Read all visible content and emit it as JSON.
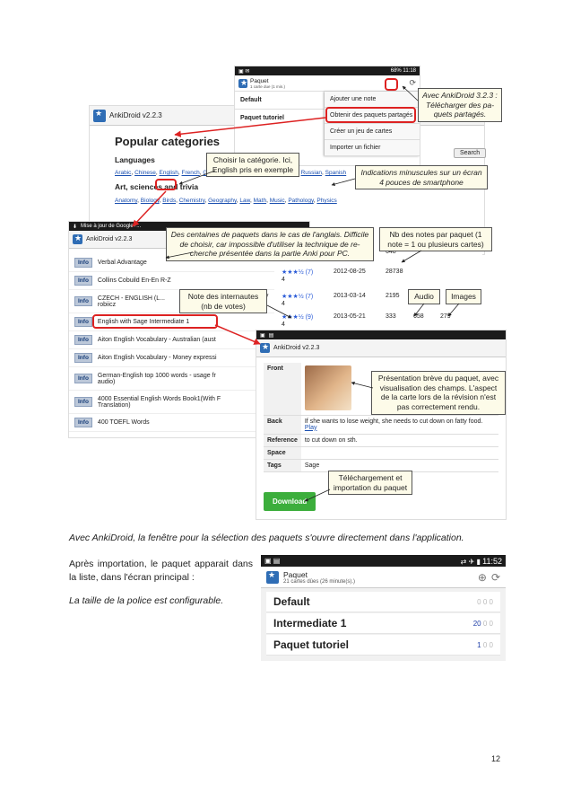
{
  "shot_main": {
    "app_title": "AnkiDroid v2.2.3",
    "heading": "Popular categories",
    "languages_label": "Languages",
    "languages_links": [
      "Arabic",
      "Chinese",
      "English",
      "French",
      "German",
      "Hebrew",
      "Japanese",
      "Korean",
      "Russian",
      "Spanish"
    ],
    "art_label": "Art, sciences and trivia",
    "art_links": [
      "Anatomy",
      "Biology",
      "Birds",
      "Chemistry",
      "Geography",
      "Law",
      "Math",
      "Music",
      "Pathology",
      "Physics"
    ],
    "search_button": "Search"
  },
  "shot_menu": {
    "status_time": "11:18",
    "status_battery": "68%",
    "title": "Paquet",
    "subtitle": "1 carte due (1 min.)",
    "decks": [
      "Default",
      "Paquet tutoriel"
    ],
    "menu_items": [
      "Ajouter une note",
      "Obtenir des paquets partagés",
      "Créer un jeu de cartes",
      "Importer un fichier"
    ]
  },
  "shot_list": {
    "notification": "Mise à jour de Google+...",
    "app_title": "AnkiDroid v2.2.3",
    "info_label": "Info",
    "rows": [
      {
        "name": "Verbal Advantage",
        "rating": "4",
        "date": "2012-12-30",
        "notes": "648",
        "audio": "",
        "images": ""
      },
      {
        "name": "Collins Cobuild En-En R-Z",
        "rating": "★★★½ (7)",
        "rating2": "4",
        "date": "2012-08-25",
        "notes": "28738",
        "audio": "",
        "images": ""
      },
      {
        "name": "CZECH - ENGLISH (L...",
        "sub": "robiicz",
        "by": "by",
        "rating": "★★★½ (7)",
        "rating2": "4",
        "date": "2013-03-14",
        "notes": "2195",
        "audio": "",
        "images": ""
      },
      {
        "name": "English with Sage Intermediate 1",
        "rating": "★★★½ (9)",
        "rating2": "4",
        "date": "2013-05-21",
        "notes": "333",
        "audio": "658",
        "images": "279"
      },
      {
        "name": "Aiton English Vocabulary - Australian (aust",
        "rating": "",
        "date": "",
        "notes": ""
      },
      {
        "name": "Aiton English Vocabulary - Money expressi",
        "rating": "",
        "date": "",
        "notes": ""
      },
      {
        "name": "German-English top 1000 words - usage fr",
        "sub": "audio)",
        "rating": "",
        "date": "",
        "notes": ""
      },
      {
        "name": "4000 Essential English Words Book1(With F",
        "sub": "Translation)",
        "rating": "",
        "date": "",
        "notes": ""
      },
      {
        "name": "400 TOEFL Words",
        "rating": "",
        "date": "",
        "notes": ""
      }
    ]
  },
  "shot_detail": {
    "app_title": "AnkiDroid v2.2.3",
    "fields": [
      {
        "key": "Front",
        "value": ""
      },
      {
        "key": "Back",
        "value": "If she wants to lose weight, she needs to cut down on fatty food.",
        "link": "Play"
      },
      {
        "key": "Reference",
        "value": "to cut down on sth."
      },
      {
        "key": "Space",
        "value": ""
      },
      {
        "key": "Tags",
        "value": "Sage"
      }
    ],
    "download_button": "Download"
  },
  "annotations": {
    "ankidroid_version": "Avec AnkiDroid 3.2.3 : Télécharger des pa-quets partagés.",
    "choose_category": "Choisir la catégorie. Ici, English pris en exemple",
    "small_text": "Indications minuscules sur un écran 4 pouces de smartphone",
    "hundreds_decks": "Des centaines de paquets dans le cas de l'anglais. Difficile de choisir, car impossible d'utiliser la technique de re-cherche présentée dans la partie Anki pour PC.",
    "nb_notes": "Nb des notes par paquet (1 note = 1 ou plusieurs cartes)",
    "user_rating": "Note des internautes (nb de votes)",
    "audio": "Audio",
    "images": "Images",
    "presentation": "Présentation brève du paquet, avec visualisation des champs. L'aspect de la carte lors de la révision n'est pas correctement rendu.",
    "download_note": "Téléchargement et importation du paquet"
  },
  "body_text": {
    "caption": "Avec AnkiDroid, la fenêtre pour la sélection des paquets s'ouvre directement dans l'application.",
    "after_import": "Après importation, le paquet apparait dans la liste, dans l'écran principal :",
    "font_size": "La taille de la police est configurable."
  },
  "shot_bottom": {
    "status_time": "11:52",
    "title": "Paquet",
    "subtitle": "21 cartes dûes (26 minute(s).)",
    "decks": [
      {
        "name": "Default",
        "c1": "0",
        "c2": "0",
        "c3": "0"
      },
      {
        "name": "Intermediate 1",
        "c1": "20",
        "c2": "0",
        "c3": "0"
      },
      {
        "name": "Paquet tutoriel",
        "c1": "1",
        "c2": "0",
        "c3": "0"
      }
    ]
  },
  "page_number": "12"
}
